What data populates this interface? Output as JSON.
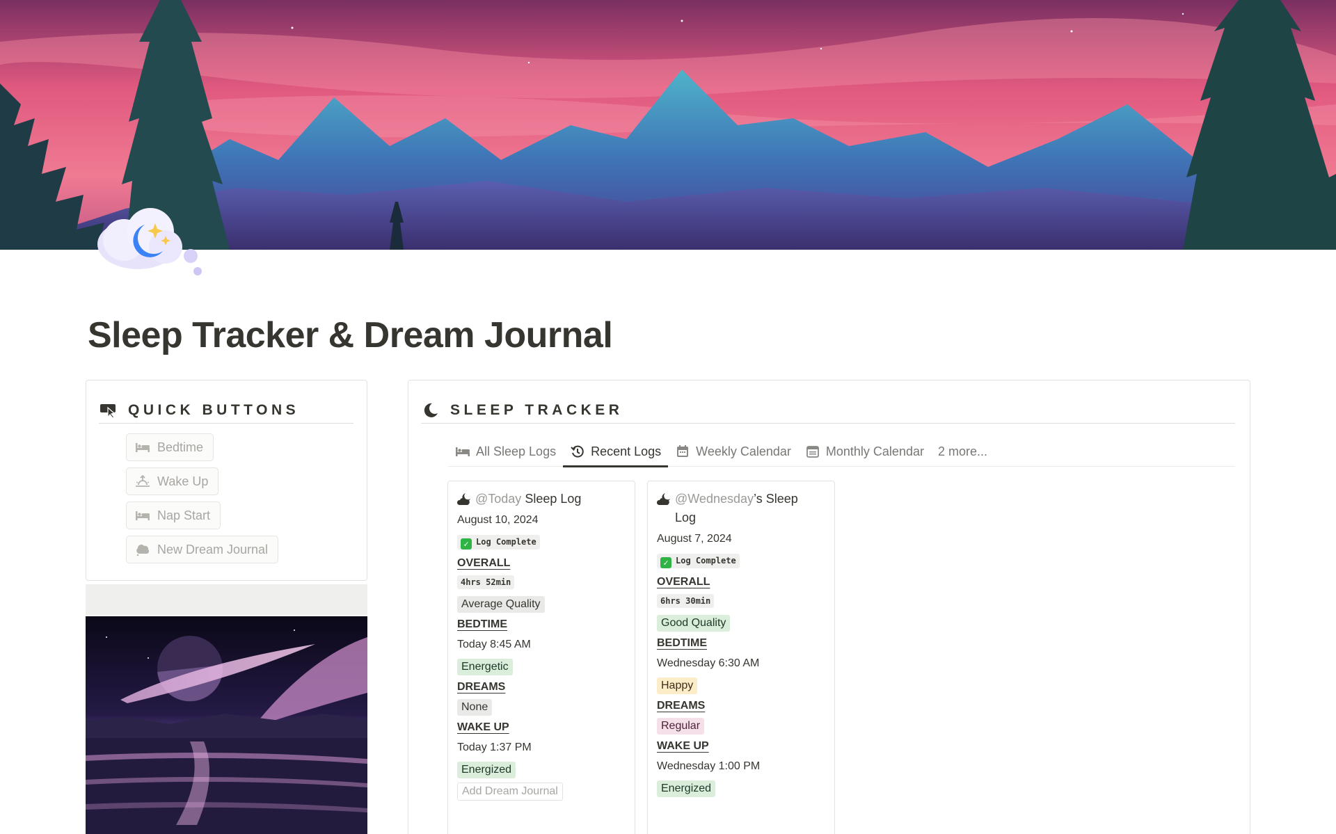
{
  "page": {
    "title": "Sleep Tracker & Dream Journal"
  },
  "quick_buttons": {
    "heading": "QUICK BUTTONS",
    "icon": "cursor-click-icon",
    "buttons": [
      {
        "label": "Bedtime",
        "icon": "bed-icon"
      },
      {
        "label": "Wake Up",
        "icon": "sunrise-icon"
      },
      {
        "label": "Nap Start",
        "icon": "bed-icon"
      },
      {
        "label": "New Dream Journal",
        "icon": "cloud-icon"
      }
    ]
  },
  "sleep_tracker": {
    "heading": "SLEEP TRACKER",
    "icon": "moon-icon",
    "tabs": [
      {
        "label": "All Sleep Logs",
        "icon": "bed-icon",
        "active": false
      },
      {
        "label": "Recent Logs",
        "icon": "history-icon",
        "active": true
      },
      {
        "label": "Weekly Calendar",
        "icon": "calendar-icon",
        "active": false
      },
      {
        "label": "Monthly Calendar",
        "icon": "calendar-icon",
        "active": false
      },
      {
        "label": "2 more...",
        "icon": "",
        "active": false
      }
    ],
    "cards": [
      {
        "mention": "@Today",
        "title_rest": " Sleep Log",
        "title_rest2": "",
        "date": "August 10, 2024",
        "status": "Log Complete",
        "overall_label": "OVERALL",
        "duration": "4hrs 52min",
        "quality": "Average Quality",
        "bedtime_label": "BEDTIME",
        "bedtime": "Today 8:45 AM",
        "bedtime_mood": "Energetic",
        "dreams_label": "DREAMS",
        "dreams": "None",
        "wakeup_label": "WAKE UP",
        "wakeup": "Today 1:37 PM",
        "wakeup_mood": "Energized",
        "journal": "Add Dream Journal"
      },
      {
        "mention": "@Wednesday",
        "title_rest": "’s Sleep",
        "title_rest2": "Log",
        "date": "August 7, 2024",
        "status": "Log Complete",
        "overall_label": "OVERALL",
        "duration": "6hrs 30min",
        "quality": "Good Quality",
        "bedtime_label": "BEDTIME",
        "bedtime": "Wednesday 6:30 AM",
        "bedtime_mood": "Happy",
        "dreams_label": "DREAMS",
        "dreams": "Regular",
        "wakeup_label": "WAKE UP",
        "wakeup": "Wednesday 1:00 PM",
        "wakeup_mood": "Energized",
        "journal": ""
      }
    ]
  },
  "colors": {
    "text": "#37352f",
    "muted": "#787774",
    "tag_green": "#dbeddb",
    "tag_gray": "#e9e9e7",
    "tag_yellow": "#fdecc8",
    "tag_pink": "#f5e0e9",
    "check_green": "#2fb344"
  }
}
